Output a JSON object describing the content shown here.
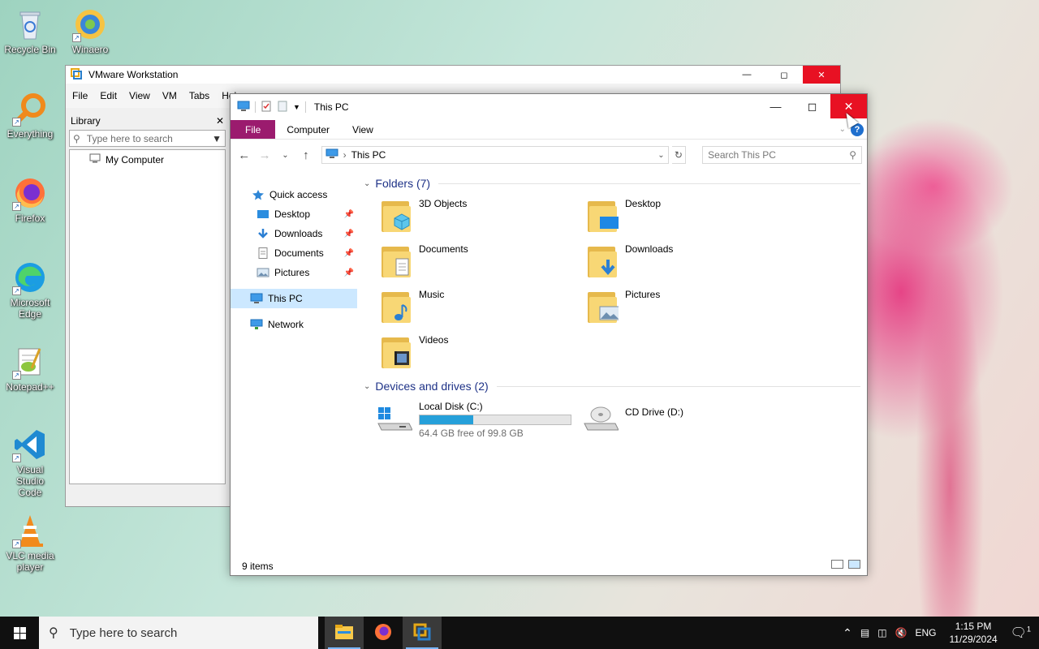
{
  "desktop": {
    "icons": [
      {
        "label": "Recycle Bin"
      },
      {
        "label": "Winaero Tweaker"
      },
      {
        "label": "Everything"
      },
      {
        "label": "Firefox"
      },
      {
        "label": "Microsoft Edge"
      },
      {
        "label": "Notepad++"
      },
      {
        "label": "Visual Studio Code"
      },
      {
        "label": "VLC media player"
      }
    ]
  },
  "vmware": {
    "title": "VMware Workstation",
    "menu": [
      "File",
      "Edit",
      "View",
      "VM",
      "Tabs",
      "Help"
    ],
    "library": {
      "title": "Library",
      "search_placeholder": "Type here to search",
      "items": [
        "My Computer"
      ]
    }
  },
  "explorer": {
    "title": "This PC",
    "ribbon_tabs": [
      "File",
      "Computer",
      "View"
    ],
    "address": "This PC",
    "search_placeholder": "Search This PC",
    "nav": {
      "quick_access": "Quick access",
      "pinned": [
        "Desktop",
        "Downloads",
        "Documents",
        "Pictures"
      ],
      "this_pc": "This PC",
      "network": "Network"
    },
    "folders_header": "Folders (7)",
    "folders": [
      "3D Objects",
      "Desktop",
      "Documents",
      "Downloads",
      "Music",
      "Pictures",
      "Videos"
    ],
    "drives_header": "Devices and drives (2)",
    "drives": [
      {
        "name": "Local Disk (C:)",
        "free": "64.4 GB free of 99.8 GB",
        "used_fraction": 0.355
      },
      {
        "name": "CD Drive (D:)"
      }
    ],
    "status": "9 items"
  },
  "taskbar": {
    "search_placeholder": "Type here to search",
    "lang": "ENG",
    "time": "1:15 PM",
    "date": "11/29/2024",
    "notifications": "1"
  }
}
